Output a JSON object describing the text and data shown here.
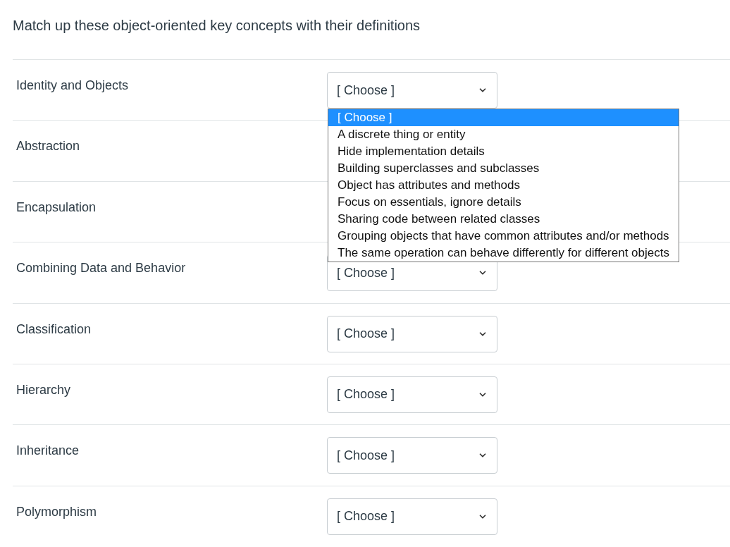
{
  "title": "Match up these object-oriented key concepts with their definitions",
  "rows": [
    {
      "label": "Identity and Objects",
      "select": {
        "value": "[ Choose ]",
        "open": true,
        "options": [
          {
            "label": "[ Choose ]",
            "selected": true
          },
          {
            "label": "A discrete thing or entity",
            "selected": false
          },
          {
            "label": "Hide implementation details",
            "selected": false
          },
          {
            "label": "Building superclasses and subclasses",
            "selected": false
          },
          {
            "label": "Object has attributes and methods",
            "selected": false
          },
          {
            "label": "Focus on essentials, ignore details",
            "selected": false
          },
          {
            "label": "Sharing code between related classes",
            "selected": false
          },
          {
            "label": "Grouping objects that have common attributes and/or methods",
            "selected": false
          },
          {
            "label": "The same operation can behave differently for different objects",
            "selected": false
          }
        ]
      }
    },
    {
      "label": "Abstraction"
    },
    {
      "label": "Encapsulation"
    },
    {
      "label": "Combining Data and Behavior",
      "select": {
        "value": "[ Choose ]"
      }
    },
    {
      "label": "Classification",
      "select": {
        "value": "[ Choose ]"
      }
    },
    {
      "label": "Hierarchy",
      "select": {
        "value": "[ Choose ]"
      }
    },
    {
      "label": "Inheritance",
      "select": {
        "value": "[ Choose ]"
      }
    },
    {
      "label": "Polymorphism",
      "select": {
        "value": "[ Choose ]"
      }
    }
  ]
}
